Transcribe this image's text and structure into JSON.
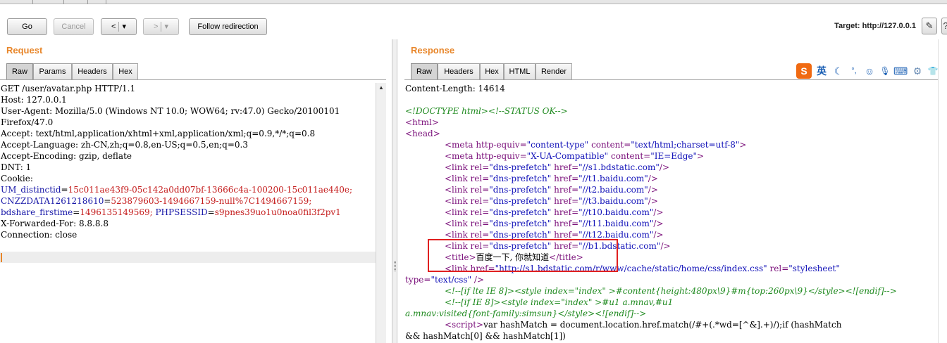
{
  "toolbar": {
    "go_label": "Go",
    "cancel_label": "Cancel",
    "back_label": "<",
    "back_menu": "▾",
    "forward_label": ">",
    "forward_menu": "▾",
    "follow_label": "Follow redirection",
    "target_label": "Target: http://127.0.0.1",
    "edit_icon": "pencil-icon",
    "help_icon": "help-icon"
  },
  "request": {
    "title": "Request",
    "tabs": [
      {
        "label": "Raw",
        "active": true
      },
      {
        "label": "Params",
        "active": false
      },
      {
        "label": "Headers",
        "active": false
      },
      {
        "label": "Hex",
        "active": false
      }
    ],
    "lines": [
      {
        "text": "GET /user/avatar.php HTTP/1.1"
      },
      {
        "text": "Host: 127.0.0.1"
      },
      {
        "text": "User-Agent: Mozilla/5.0 (Windows NT 10.0; WOW64; rv:47.0) Gecko/20100101"
      },
      {
        "text": "Firefox/47.0"
      },
      {
        "text": "Accept: text/html,application/xhtml+xml,application/xml;q=0.9,*/*;q=0.8"
      },
      {
        "text": "Accept-Language: zh-CN,zh;q=0.8,en-US;q=0.5,en;q=0.3"
      },
      {
        "text": "Accept-Encoding: gzip, deflate"
      },
      {
        "text": "DNT: 1"
      },
      {
        "text": "Cookie:"
      },
      {
        "name": "UM_distinctid",
        "value": "15c011ae43f9-05c142a0dd07bf-13666c4a-100200-15c011ae440e;"
      },
      {
        "name": "CNZZDATA1261218610",
        "value": "523879603-1494667159-null%7C1494667159;"
      },
      {
        "name": "bdshare_firstime",
        "value": "1496135149569;",
        "name2": "PHPSESSID",
        "value2": "s9pnes39uo1u0noa0fil3f2pv1"
      },
      {
        "text": "X-Forwarded-For: 8.8.8.8"
      },
      {
        "text": "Connection: close"
      }
    ]
  },
  "response": {
    "title": "Response",
    "tabs": [
      {
        "label": "Raw",
        "active": true
      },
      {
        "label": "Headers",
        "active": false
      },
      {
        "label": "Hex",
        "active": false
      },
      {
        "label": "HTML",
        "active": false
      },
      {
        "label": "Render",
        "active": false
      }
    ],
    "ime_icons": [
      "sogou-s-icon",
      "english-mode-icon",
      "moon-icon",
      "punctuation-icon",
      "emoji-icon",
      "microphone-icon",
      "keyboard-icon",
      "user-settings-icon",
      "shirt-icon",
      "grid-menu-icon"
    ],
    "ime_glyphs": [
      "S",
      "英",
      "☾",
      "°,",
      "☺",
      "🎙",
      "⌨",
      "⚙",
      "👕",
      "▦"
    ],
    "colors": {
      "accent": "#e8862a",
      "highlight_box": "#e02020",
      "tag": "#7a0f7a",
      "value": "#1010b8",
      "comment": "#1f8a1f"
    },
    "content_length": "Content-Length: 14614",
    "code": [
      {
        "parts": [
          {
            "c": "cmt",
            "t": "<!DOCTYPE html><!--STATUS OK-->"
          }
        ]
      },
      {
        "parts": [
          {
            "c": "tag",
            "t": "<html>"
          }
        ]
      },
      {
        "parts": [
          {
            "c": "tag",
            "t": "<head>"
          }
        ]
      },
      {
        "indent": true,
        "parts": [
          {
            "c": "tag",
            "t": "<meta "
          },
          {
            "c": "attr",
            "t": "http-equiv="
          },
          {
            "c": "val",
            "t": "\"content-type\" "
          },
          {
            "c": "attr",
            "t": "content="
          },
          {
            "c": "val",
            "t": "\"text/html;charset=utf-8\""
          },
          {
            "c": "tag",
            "t": ">"
          }
        ]
      },
      {
        "indent": true,
        "parts": [
          {
            "c": "tag",
            "t": "<meta "
          },
          {
            "c": "attr",
            "t": "http-equiv="
          },
          {
            "c": "val",
            "t": "\"X-UA-Compatible\" "
          },
          {
            "c": "attr",
            "t": "content="
          },
          {
            "c": "val",
            "t": "\"IE=Edge\""
          },
          {
            "c": "tag",
            "t": ">"
          }
        ]
      },
      {
        "indent": true,
        "parts": [
          {
            "c": "tag",
            "t": "<link "
          },
          {
            "c": "attr",
            "t": "rel="
          },
          {
            "c": "val",
            "t": "\"dns-prefetch\" "
          },
          {
            "c": "attr",
            "t": "href="
          },
          {
            "c": "val",
            "t": "\"//s1.bdstatic.com\""
          },
          {
            "c": "tag",
            "t": "/>"
          }
        ]
      },
      {
        "indent": true,
        "parts": [
          {
            "c": "tag",
            "t": "<link "
          },
          {
            "c": "attr",
            "t": "rel="
          },
          {
            "c": "val",
            "t": "\"dns-prefetch\" "
          },
          {
            "c": "attr",
            "t": "href="
          },
          {
            "c": "val",
            "t": "\"//t1.baidu.com\""
          },
          {
            "c": "tag",
            "t": "/>"
          }
        ]
      },
      {
        "indent": true,
        "parts": [
          {
            "c": "tag",
            "t": "<link "
          },
          {
            "c": "attr",
            "t": "rel="
          },
          {
            "c": "val",
            "t": "\"dns-prefetch\" "
          },
          {
            "c": "attr",
            "t": "href="
          },
          {
            "c": "val",
            "t": "\"//t2.baidu.com\""
          },
          {
            "c": "tag",
            "t": "/>"
          }
        ]
      },
      {
        "indent": true,
        "parts": [
          {
            "c": "tag",
            "t": "<link "
          },
          {
            "c": "attr",
            "t": "rel="
          },
          {
            "c": "val",
            "t": "\"dns-prefetch\" "
          },
          {
            "c": "attr",
            "t": "href="
          },
          {
            "c": "val",
            "t": "\"//t3.baidu.com\""
          },
          {
            "c": "tag",
            "t": "/>"
          }
        ]
      },
      {
        "indent": true,
        "parts": [
          {
            "c": "tag",
            "t": "<link "
          },
          {
            "c": "attr",
            "t": "rel="
          },
          {
            "c": "val",
            "t": "\"dns-prefetch\" "
          },
          {
            "c": "attr",
            "t": "href="
          },
          {
            "c": "val",
            "t": "\"//t10.baidu.com\""
          },
          {
            "c": "tag",
            "t": "/>"
          }
        ]
      },
      {
        "indent": true,
        "parts": [
          {
            "c": "tag",
            "t": "<link "
          },
          {
            "c": "attr",
            "t": "rel="
          },
          {
            "c": "val",
            "t": "\"dns-prefetch\" "
          },
          {
            "c": "attr",
            "t": "href="
          },
          {
            "c": "val",
            "t": "\"//t11.baidu.com\""
          },
          {
            "c": "tag",
            "t": "/>"
          }
        ]
      },
      {
        "indent": true,
        "parts": [
          {
            "c": "tag",
            "t": "<link "
          },
          {
            "c": "attr",
            "t": "rel="
          },
          {
            "c": "val",
            "t": "\"dns-prefetch\" "
          },
          {
            "c": "attr",
            "t": "href="
          },
          {
            "c": "val",
            "t": "\"//t12.baidu.com\""
          },
          {
            "c": "tag",
            "t": "/>"
          }
        ]
      },
      {
        "indent": true,
        "parts": [
          {
            "c": "tag",
            "t": "<link "
          },
          {
            "c": "attr",
            "t": "rel="
          },
          {
            "c": "val",
            "t": "\"dns-prefetch\" "
          },
          {
            "c": "attr",
            "t": "href="
          },
          {
            "c": "val",
            "t": "\"//b1.bdstatic.com\""
          },
          {
            "c": "tag",
            "t": "/>"
          }
        ]
      },
      {
        "indent": true,
        "parts": [
          {
            "c": "tag",
            "t": "<title>"
          },
          {
            "c": "txt",
            "t": "百度一下, 你就知道"
          },
          {
            "c": "tag",
            "t": "</title>"
          }
        ]
      },
      {
        "indent": true,
        "parts": [
          {
            "c": "tag",
            "t": "<link "
          },
          {
            "c": "attr",
            "t": "href="
          },
          {
            "c": "val",
            "t": "\"http://s1.bdstatic.com/r/www/cache/static/home/css/index.css\" "
          },
          {
            "c": "attr",
            "t": "rel="
          },
          {
            "c": "val",
            "t": "\"stylesheet\""
          }
        ]
      },
      {
        "parts": [
          {
            "c": "attr",
            "t": "type="
          },
          {
            "c": "val",
            "t": "\"text/css\" "
          },
          {
            "c": "tag",
            "t": "/>"
          }
        ]
      },
      {
        "indent": true,
        "parts": [
          {
            "c": "cmt",
            "t": "<!--[if lte IE 8]><style index=\"index\" >#content{height:480px\\9}#m{top:260px\\9}</style><![endif]-->"
          }
        ]
      },
      {
        "indent": true,
        "parts": [
          {
            "c": "cmt",
            "t": "<!--[if IE 8]><style index=\"index\" >#u1 a.mnav,#u1"
          }
        ]
      },
      {
        "parts": [
          {
            "c": "cmt",
            "t": "a.mnav:visited{font-family:simsun}</style><![endif]-->"
          }
        ]
      },
      {
        "indent": true,
        "parts": [
          {
            "c": "tag",
            "t": "<script>"
          },
          {
            "c": "txt",
            "t": "var hashMatch = document.location.href.match(/#+(.*wd=[^&].+)/);if (hashMatch"
          }
        ]
      },
      {
        "parts": [
          {
            "c": "txt",
            "t": "&& hashMatch[0] && hashMatch[1])"
          }
        ]
      }
    ]
  }
}
